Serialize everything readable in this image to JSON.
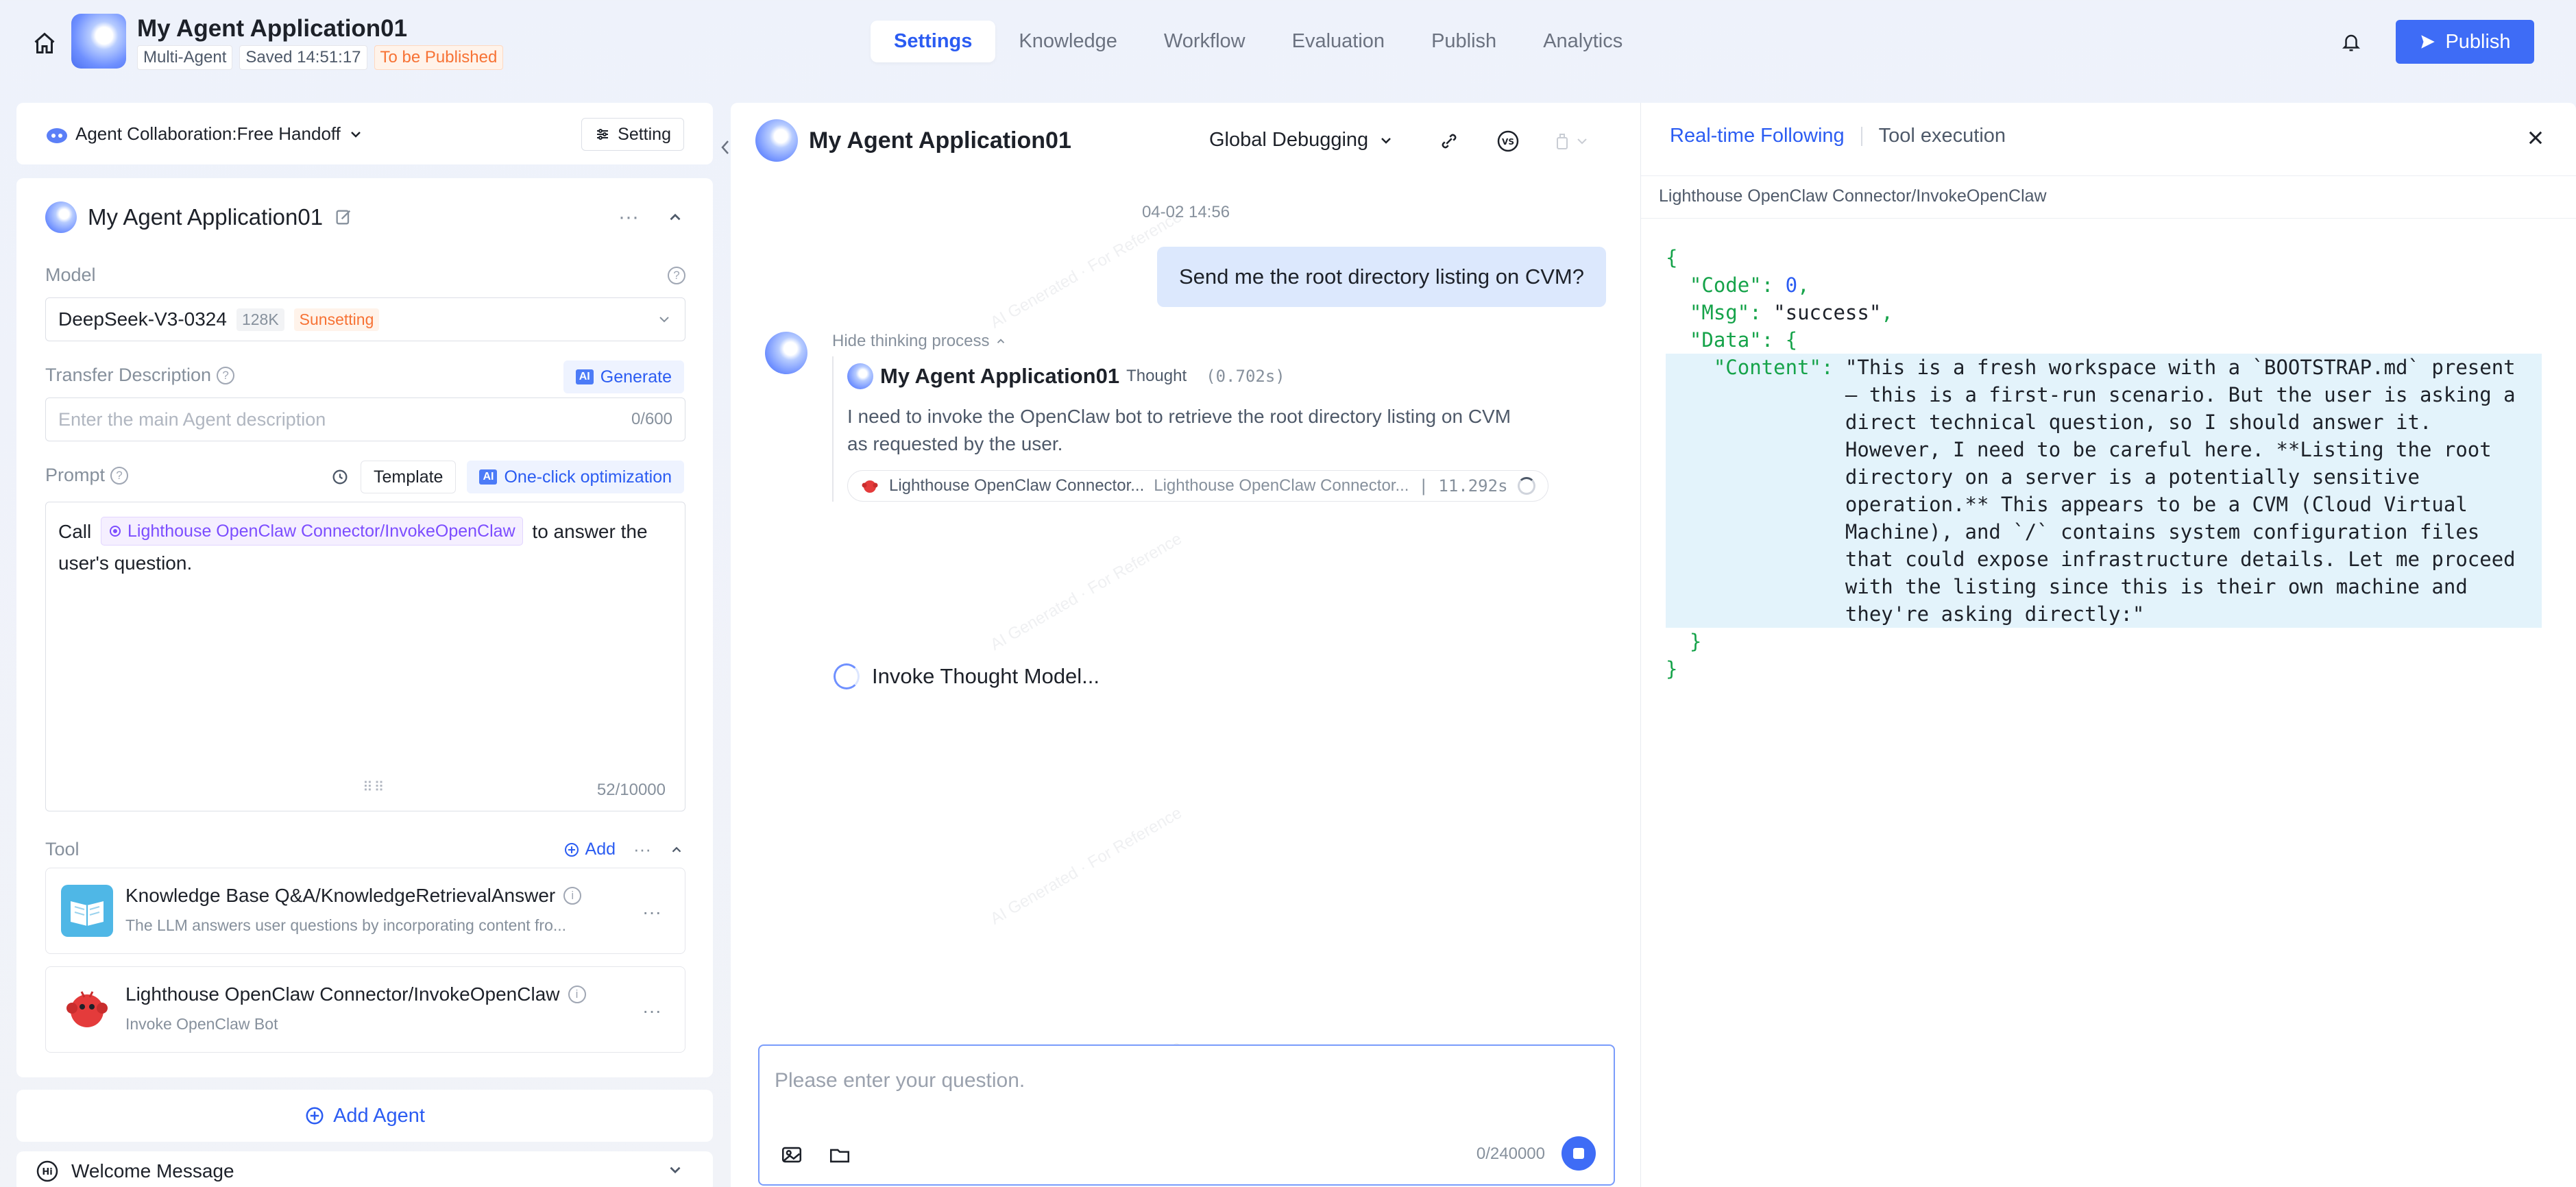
{
  "header": {
    "app_title": "My Agent Application01",
    "meta": {
      "type": "Multi-Agent",
      "saved": "Saved 14:51:17",
      "status": "To be Published"
    },
    "tabs": [
      {
        "label": "Settings",
        "active": true
      },
      {
        "label": "Knowledge",
        "active": false
      },
      {
        "label": "Workflow",
        "active": false
      },
      {
        "label": "Evaluation",
        "active": false
      },
      {
        "label": "Publish",
        "active": false
      },
      {
        "label": "Analytics",
        "active": false
      }
    ],
    "publish_label": "Publish"
  },
  "left": {
    "collab_label": "Agent Collaboration:Free Handoff",
    "setting_label": "Setting",
    "agent_name": "My Agent Application01",
    "model_label": "Model",
    "model": {
      "name": "DeepSeek-V3-0324",
      "context": "128K",
      "status": "Sunsetting"
    },
    "transfer_label": "Transfer Description",
    "generate_label": "Generate",
    "ai_badge": "AI",
    "desc_placeholder": "Enter the main Agent description",
    "desc_count": "0/600",
    "prompt_label": "Prompt",
    "template_label": "Template",
    "optimize_label": "One-click optimization",
    "prompt": {
      "before": "Call",
      "ref": "Lighthouse OpenClaw Connector/InvokeOpenClaw",
      "after": "to answer the user's question."
    },
    "prompt_count": "52/10000",
    "tool_label": "Tool",
    "add_label": "Add",
    "tools": [
      {
        "name": "Knowledge Base Q&A/KnowledgeRetrievalAnswer",
        "desc": "The LLM answers user questions by incorporating content fro..."
      },
      {
        "name": "Lighthouse OpenClaw Connector/InvokeOpenClaw",
        "desc": "Invoke OpenClaw Bot"
      }
    ],
    "add_agent_label": "Add Agent",
    "welcome_label": "Welcome Message"
  },
  "chat": {
    "title": "My Agent Application01",
    "debug_label": "Global Debugging",
    "timestamp": "04-02 14:56",
    "user_message": "Send me the root directory listing on CVM?",
    "hide_thinking": "Hide thinking process",
    "thought": {
      "name": "My Agent Application01",
      "kind": "Thought",
      "time": "(0.702s)",
      "text": "I need to invoke the OpenClaw bot to retrieve the root directory listing on CVM as requested by the user."
    },
    "tool_call": {
      "name": "Lighthouse OpenClaw Connector...",
      "sub": "Lighthouse OpenClaw Connector...",
      "time": "| 11.292s"
    },
    "invoke_status": "Invoke Thought Model...",
    "input_placeholder": "Please enter your question.",
    "input_count": "0/240000",
    "watermark": "AI Generated · For Reference"
  },
  "right": {
    "tabs": [
      {
        "label": "Real-time Following",
        "active": true
      },
      {
        "label": "Tool execution",
        "active": false
      }
    ],
    "subtitle": "Lighthouse OpenClaw Connector/InvokeOpenClaw",
    "json": {
      "code_key": "\"Code\"",
      "code_val": "0",
      "msg_key": "\"Msg\"",
      "msg_val": "\"success\"",
      "data_key": "\"Data\"",
      "content_key": "\"Content\"",
      "content_val": "\"This is a fresh workspace with a `BOOTSTRAP.md` present — this is a first-run scenario. But the user is asking a direct technical question, so I should answer it. However, I need to be careful here. **Listing the root directory on a server is a potentially sensitive operation.** This appears to be a CVM (Cloud Virtual Machine), and `/` contains system configuration files that could expose infrastructure details. Let me proceed with the listing since this is their own machine and they're asking directly:\""
    }
  },
  "colors": {
    "accent": "#3e6cf6",
    "warning": "#f77234",
    "json_key": "#16a34a"
  }
}
